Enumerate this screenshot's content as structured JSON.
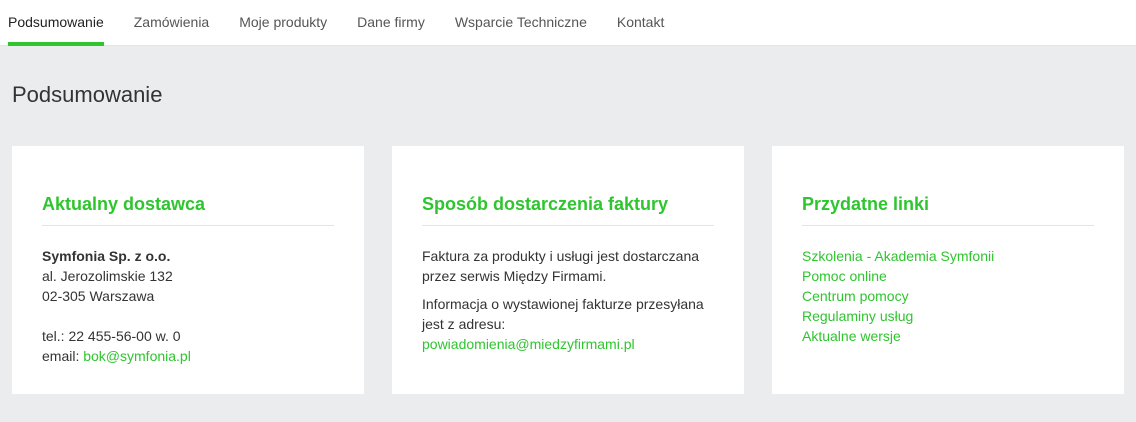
{
  "nav": {
    "tabs": [
      {
        "label": "Podsumowanie",
        "active": true
      },
      {
        "label": "Zamówienia"
      },
      {
        "label": "Moje produkty"
      },
      {
        "label": "Dane firmy"
      },
      {
        "label": "Wsparcie Techniczne"
      },
      {
        "label": "Kontakt"
      }
    ]
  },
  "page": {
    "title": "Podsumowanie"
  },
  "supplier": {
    "heading": "Aktualny dostawca",
    "company": "Symfonia Sp. z o.o.",
    "street": "al. Jerozolimskie 132",
    "city": "02-305 Warszawa",
    "phone": "tel.: 22 455-56-00 w. 0",
    "email_label": "email: ",
    "email": "bok@symfonia.pl"
  },
  "invoice": {
    "heading": "Sposób dostarczenia faktury",
    "text1": "Faktura za produkty i usługi jest dostarczana przez serwis Między Firmami.",
    "text2": "Informacja o wystawionej fakturze przesyłana jest z adresu:",
    "email": "powiadomienia@miedzyfirmami.pl"
  },
  "links": {
    "heading": "Przydatne linki",
    "items": [
      "Szkolenia - Akademia Symfonii",
      "Pomoc online",
      "Centrum pomocy",
      "Regulaminy usług",
      "Aktualne wersje"
    ]
  },
  "colors": {
    "accent": "#2ec52e",
    "background": "#ebecee",
    "card": "#ffffff"
  }
}
